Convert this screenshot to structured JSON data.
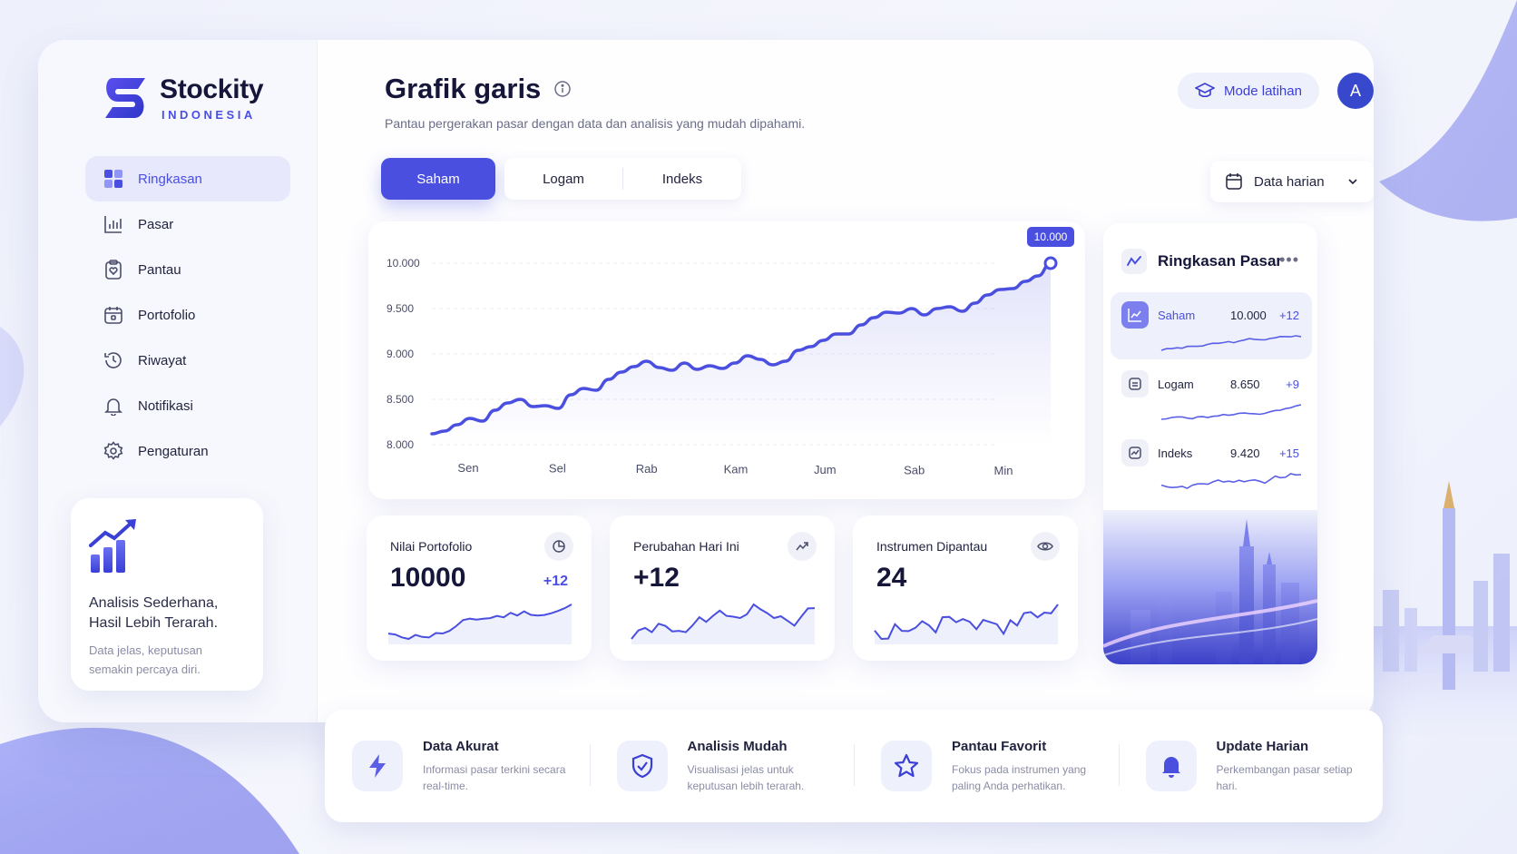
{
  "brand": {
    "name": "Stockity",
    "sub": "INDONESIA"
  },
  "sidebar": {
    "items": [
      {
        "label": "Ringkasan",
        "icon": "grid-icon"
      },
      {
        "label": "Pasar",
        "icon": "bar-chart-icon"
      },
      {
        "label": "Pantau",
        "icon": "clipboard-heart-icon"
      },
      {
        "label": "Portofolio",
        "icon": "calendar-icon"
      },
      {
        "label": "Riwayat",
        "icon": "history-icon"
      },
      {
        "label": "Notifikasi",
        "icon": "bell-icon"
      },
      {
        "label": "Pengaturan",
        "icon": "gear-icon"
      }
    ],
    "promo": {
      "title": "Analisis Sederhana, Hasil Lebih Terarah.",
      "text": "Data jelas, keputusan semakin percaya diri."
    }
  },
  "header": {
    "title": "Grafik garis",
    "subtitle": "Pantau pergerakan pasar dengan data dan analisis yang mudah dipahami.",
    "mode_label": "Mode latihan",
    "avatar_initial": "A"
  },
  "tabs": [
    {
      "label": "Saham"
    },
    {
      "label": "Logam"
    },
    {
      "label": "Indeks"
    }
  ],
  "period": {
    "label": "Data harian"
  },
  "chart_data": {
    "type": "line",
    "x": [
      "Sen",
      "Sel",
      "Rab",
      "Kam",
      "Jum",
      "Sab",
      "Min"
    ],
    "y_ticks": [
      "10.000",
      "9.500",
      "9.000",
      "8.500",
      "8.000"
    ],
    "ylim": [
      8000,
      10000
    ],
    "values": [
      8120,
      8150,
      8220,
      8290,
      8260,
      8380,
      8460,
      8500,
      8420,
      8430,
      8400,
      8550,
      8620,
      8600,
      8720,
      8800,
      8860,
      8920,
      8850,
      8820,
      8900,
      8830,
      8870,
      8840,
      8900,
      8980,
      8940,
      8880,
      8920,
      9040,
      9080,
      9150,
      9220,
      9220,
      9320,
      9400,
      9460,
      9450,
      9500,
      9430,
      9500,
      9520,
      9470,
      9560,
      9650,
      9710,
      9720,
      9800,
      9860,
      10000
    ],
    "peak_label": "10.000",
    "grid": true,
    "color": "#4a4fe0"
  },
  "market": {
    "title": "Ringkasan Pasar",
    "rows": [
      {
        "name": "Saham",
        "value": "10.000",
        "change": "+12"
      },
      {
        "name": "Logam",
        "value": "8.650",
        "change": "+9"
      },
      {
        "name": "Indeks",
        "value": "9.420",
        "change": "+15"
      }
    ]
  },
  "stats": [
    {
      "label": "Nilai Portofolio",
      "value": "10000",
      "change": "+12",
      "icon": "pie-clock-icon"
    },
    {
      "label": "Perubahan Hari Ini",
      "value": "+12",
      "change": "",
      "icon": "trend-up-icon"
    },
    {
      "label": "Instrumen Dipantau",
      "value": "24",
      "change": "",
      "icon": "eye-icon"
    }
  ],
  "features": [
    {
      "title": "Data Akurat",
      "text": "Informasi pasar terkini secara real-time.",
      "icon": "lightning-icon"
    },
    {
      "title": "Analisis Mudah",
      "text": "Visualisasi jelas untuk keputusan lebih terarah.",
      "icon": "shield-check-icon"
    },
    {
      "title": "Pantau Favorit",
      "text": "Fokus pada instrumen yang paling Anda perhatikan.",
      "icon": "star-icon"
    },
    {
      "title": "Update Harian",
      "text": "Perkembangan pasar setiap hari.",
      "icon": "bell-icon"
    }
  ],
  "colors": {
    "accent": "#4a4fe0",
    "dark": "#15163a",
    "avatar": "#3848cc"
  }
}
